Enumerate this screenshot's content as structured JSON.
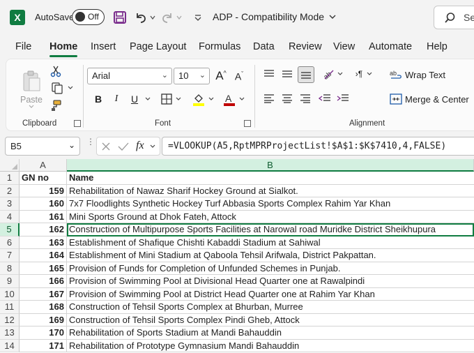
{
  "titlebar": {
    "app_logo": "X",
    "autosave_label": "AutoSave",
    "autosave_state": "Off",
    "doc_title": "ADP  -  Compatibility Mode",
    "search_text": "Se"
  },
  "menu": {
    "tabs": [
      {
        "label": "File"
      },
      {
        "label": "Home"
      },
      {
        "label": "Insert"
      },
      {
        "label": "Page Layout"
      },
      {
        "label": "Formulas"
      },
      {
        "label": "Data"
      },
      {
        "label": "Review"
      },
      {
        "label": "View"
      },
      {
        "label": "Automate"
      },
      {
        "label": "Help"
      }
    ]
  },
  "ribbon": {
    "clipboard_label": "Clipboard",
    "paste_label": "Paste",
    "font_label": "Font",
    "font_name": "Arial",
    "font_size": "10",
    "alignment_label": "Alignment",
    "wrap_text_label": "Wrap Text",
    "merge_center_label": "Merge & Center",
    "bold_glyph": "B",
    "italic_glyph": "I",
    "underline_glyph": "U",
    "increase_font_glyph": "A^",
    "decrease_font_glyph": "Aˇ",
    "accent_color": "#107c41",
    "highlight_color": "#ffff00",
    "font_color": "#c00000"
  },
  "formula_bar": {
    "name_box": "B5",
    "fx_label": "fx",
    "formula": "=VLOOKUP(A5,RptMPRProjectList!$A$1:$K$7410,4,FALSE)"
  },
  "sheet": {
    "columns": [
      "A",
      "B"
    ],
    "selected_column": "B",
    "selected_row": "5",
    "rows": [
      {
        "num": "1",
        "a": "GN no",
        "b": "Name"
      },
      {
        "num": "2",
        "a": "159",
        "b": "Rehabilitation of Nawaz Sharif Hockey Ground at Sialkot."
      },
      {
        "num": "3",
        "a": "160",
        "b": "7x7 Floodlights Synthetic Hockey Turf Abbasia Sports Complex Rahim Yar Khan"
      },
      {
        "num": "4",
        "a": "161",
        "b": "Mini Sports Ground at Dhok Fateh, Attock"
      },
      {
        "num": "5",
        "a": "162",
        "b": "Construction of Multipurpose Sports Facilities at Narowal road Muridke District Sheikhupura"
      },
      {
        "num": "6",
        "a": "163",
        "b": "Establishment of Shafique Chishti Kabaddi Stadium at Sahiwal"
      },
      {
        "num": "7",
        "a": "164",
        "b": "Establishment of Mini Stadium at Qaboola Tehsil Arifwala, District Pakpattan."
      },
      {
        "num": "8",
        "a": "165",
        "b": "Provision of Funds for Completion of Unfunded Schemes in Punjab."
      },
      {
        "num": "9",
        "a": "166",
        "b": "Provision of Swimming Pool at Divisional Head Quarter one at Rawalpindi"
      },
      {
        "num": "10",
        "a": "167",
        "b": "Provision of Swimming Pool at District Head Quarter one at Rahim Yar Khan"
      },
      {
        "num": "11",
        "a": "168",
        "b": "Construction of Tehsil Sports Complex at Bhurban, Murree"
      },
      {
        "num": "12",
        "a": "169",
        "b": "Construction of Tehsil Sports Complex Pindi Gheb, Attock"
      },
      {
        "num": "13",
        "a": "170",
        "b": "Rehabilitation of Sports Stadium at Mandi Bahauddin"
      },
      {
        "num": "14",
        "a": "171",
        "b": "Rehabilitation of Prototype Gymnasium Mandi Bahauddin"
      }
    ]
  }
}
